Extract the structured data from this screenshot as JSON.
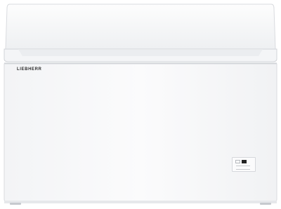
{
  "product": {
    "brand_text": "LIEBHERR",
    "body_color": "#f7f8f9",
    "edge_color": "#d9dbdf",
    "background_color": "#ffffff"
  }
}
